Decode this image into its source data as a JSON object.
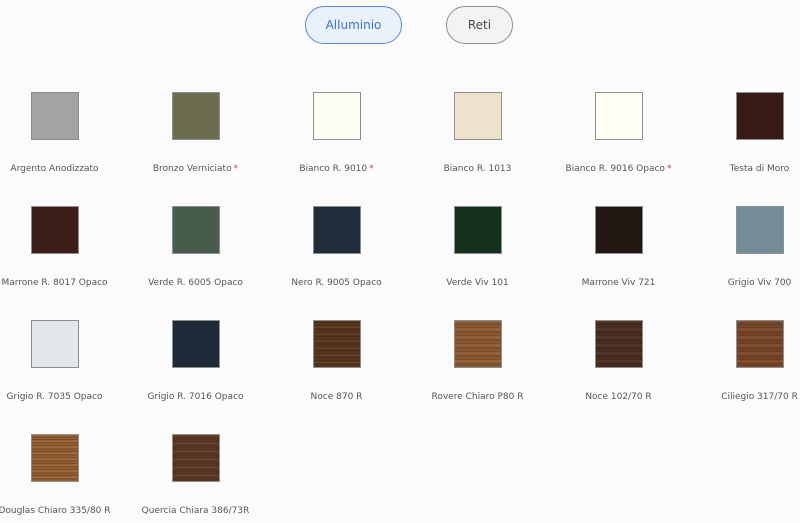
{
  "tabs": [
    {
      "label": "Alluminio",
      "active": true
    },
    {
      "label": "Reti",
      "active": false
    }
  ],
  "colors": [
    {
      "name": "Argento Anodizzato",
      "color": "#a3a3a3",
      "starred": false
    },
    {
      "name": "Bronzo Verniciato",
      "color": "#6e6c4f",
      "starred": true
    },
    {
      "name": "Bianco R. 9010",
      "color": "#fefdf2",
      "starred": true
    },
    {
      "name": "Bianco R. 1013",
      "color": "#eee1cd",
      "starred": false
    },
    {
      "name": "Bianco R. 9016 Opaco",
      "color": "#fefef5",
      "starred": true
    },
    {
      "name": "Testa di Moro",
      "color": "#3a1a14",
      "starred": false
    },
    {
      "name": "Marrone R. 8017 Opaco",
      "color": "#3c1d17",
      "starred": false
    },
    {
      "name": "Verde R. 6005 Opaco",
      "color": "#485c4d",
      "starred": false
    },
    {
      "name": "Nero R. 9005 Opaco",
      "color": "#1f2d3b",
      "starred": false
    },
    {
      "name": "Verde Viv 101",
      "color": "#16311e",
      "starred": false
    },
    {
      "name": "Marrone Viv 721",
      "color": "#231714",
      "starred": false
    },
    {
      "name": "Grigio Viv 700",
      "color": "#758c98",
      "starred": false
    },
    {
      "name": "Grigio R. 7035 Opaco",
      "color": "#e2e8ea",
      "starred": false
    },
    {
      "name": "Grigio R. 7016 Opaco",
      "color": "#1e2a37",
      "starred": false
    },
    {
      "name": "Noce 870 R",
      "color": "wood-1",
      "starred": false
    },
    {
      "name": "Rovere Chiaro P80 R",
      "color": "wood-2",
      "starred": false
    },
    {
      "name": "Noce 102/70 R",
      "color": "wood-3",
      "starred": false
    },
    {
      "name": "Ciliegio 317/70 R",
      "color": "wood-4",
      "starred": false
    },
    {
      "name": "Douglas Chiaro 335/80 R",
      "color": "wood-5",
      "starred": false
    },
    {
      "name": "Quercia Chiara 386/73R",
      "color": "wood-6",
      "starred": false
    }
  ]
}
